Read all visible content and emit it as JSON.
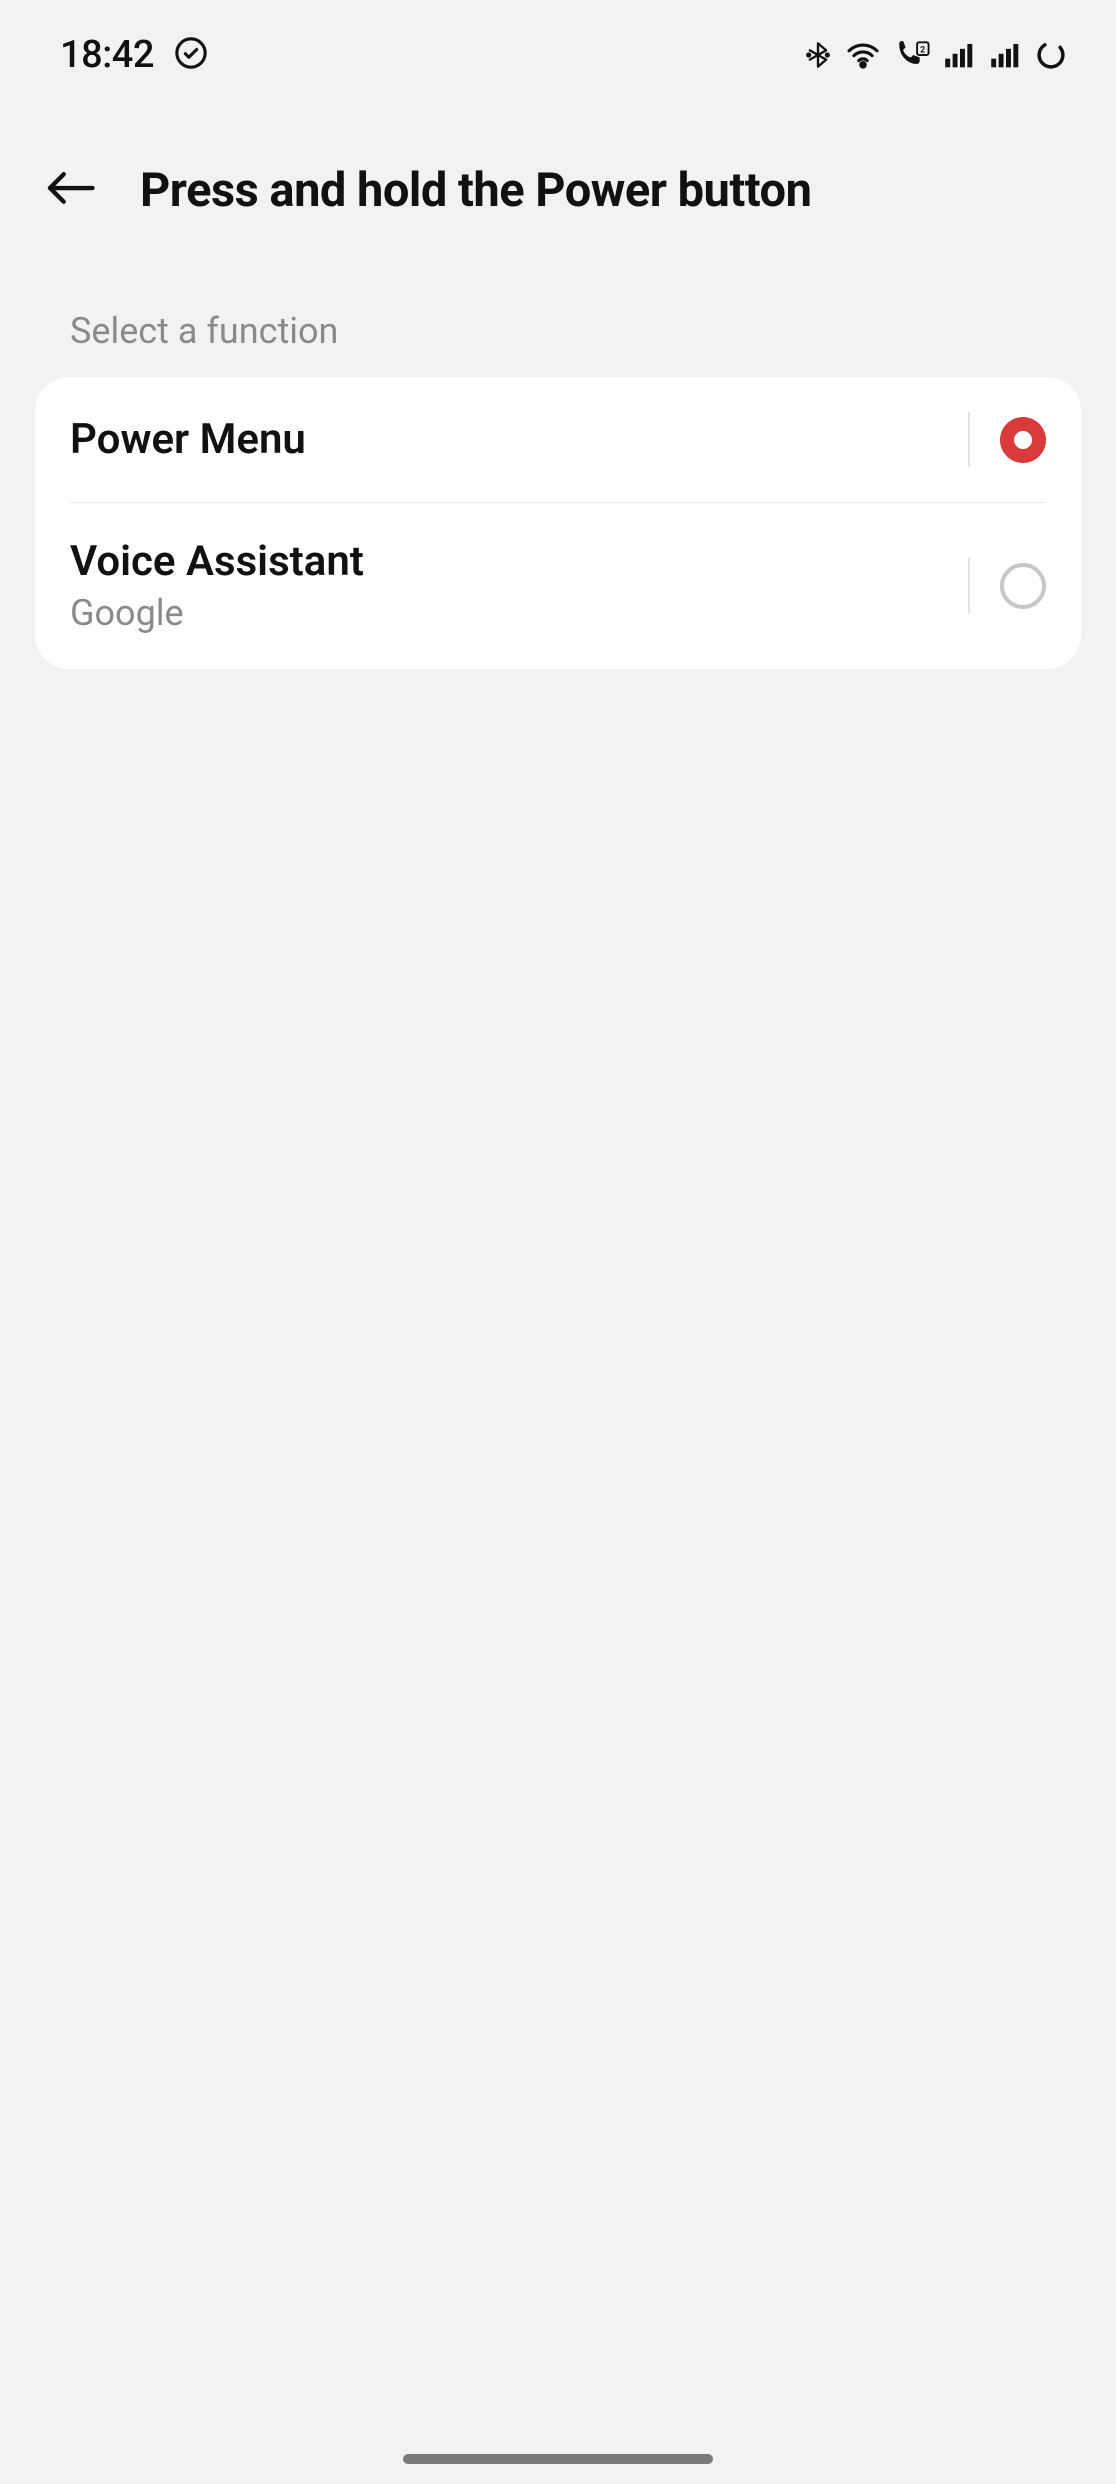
{
  "status": {
    "time": "18:42"
  },
  "header": {
    "title": "Press and hold the Power button"
  },
  "section": {
    "label": "Select a function"
  },
  "options": [
    {
      "title": "Power Menu",
      "subtitle": "",
      "selected": true
    },
    {
      "title": "Voice Assistant",
      "subtitle": "Google",
      "selected": false
    }
  ]
}
